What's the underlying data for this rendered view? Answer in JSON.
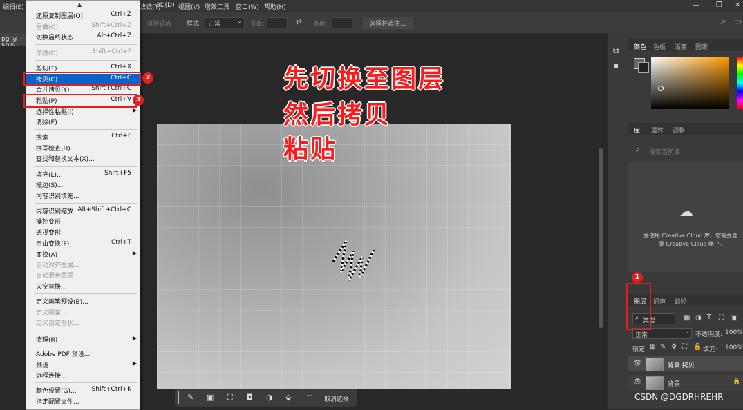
{
  "menubar": {
    "edit": "编辑(E)",
    "items": [
      "滤镜(T)",
      "3D(D)",
      "视图(V)",
      "增效工具",
      "窗口(W)",
      "帮助(H)"
    ],
    "win_min": "—",
    "win_max": "❐",
    "win_close": "✕"
  },
  "optbar": {
    "erase_refine": "消除锯齿",
    "style_label": "样式:",
    "style_value": "正常",
    "width_label": "宽度:",
    "height_label": "高度:",
    "select_subject": "选择并遮住..."
  },
  "doc_tab": "pg @ 50%",
  "annotation": {
    "line1": "先切换至图层",
    "line2": "然后拷贝",
    "line3": "粘贴"
  },
  "edit_menu": {
    "undo": {
      "label": "还原复制图层(O)",
      "shortcut": "Ctrl+Z"
    },
    "redo": {
      "label": "重做(O)",
      "shortcut": "Shift+Ctrl+Z"
    },
    "toggle_last": {
      "label": "切换最终状态",
      "shortcut": "Alt+Ctrl+Z"
    },
    "fade": {
      "label": "渐隐(D)...",
      "shortcut": "Shift+Ctrl+F"
    },
    "cut": {
      "label": "剪切(T)",
      "shortcut": "Ctrl+X"
    },
    "copy": {
      "label": "拷贝(C)",
      "shortcut": "Ctrl+C"
    },
    "copy_merged": {
      "label": "合并拷贝(Y)",
      "shortcut": "Shift+Ctrl+C"
    },
    "paste": {
      "label": "粘贴(P)",
      "shortcut": "Ctrl+V"
    },
    "paste_special": {
      "label": "选择性粘贴(I)"
    },
    "clear": {
      "label": "清除(E)"
    },
    "search": {
      "label": "搜索",
      "shortcut": "Ctrl+F"
    },
    "spell": {
      "label": "拼写检查(H)..."
    },
    "find_replace": {
      "label": "查找和替换文本(X)..."
    },
    "fill": {
      "label": "填充(L)...",
      "shortcut": "Shift+F5"
    },
    "stroke": {
      "label": "描边(S)..."
    },
    "content_fill": {
      "label": "内容识别填充..."
    },
    "content_scale": {
      "label": "内容识别缩放",
      "shortcut": "Alt+Shift+Ctrl+C"
    },
    "puppet": {
      "label": "操控变形"
    },
    "perspective": {
      "label": "透视变形"
    },
    "free_transform": {
      "label": "自由变换(F)",
      "shortcut": "Ctrl+T"
    },
    "transform": {
      "label": "变换(A)"
    },
    "auto_align": {
      "label": "自动对齐图层..."
    },
    "auto_blend": {
      "label": "自动混合图层..."
    },
    "sky_replace": {
      "label": "天空替换..."
    },
    "define_brush": {
      "label": "定义画笔预设(B)..."
    },
    "define_pattern": {
      "label": "定义图案..."
    },
    "define_shape": {
      "label": "定义自定形状..."
    },
    "purge": {
      "label": "清理(R)"
    },
    "pdf_presets": {
      "label": "Adobe PDF 预设..."
    },
    "presets": {
      "label": "预设"
    },
    "remote": {
      "label": "远程连接..."
    },
    "color_settings": {
      "label": "颜色设置(G)...",
      "shortcut": "Shift+Ctrl+K"
    },
    "assign_profile": {
      "label": "指定配置文件..."
    }
  },
  "badges": {
    "b1": "1",
    "b2": "2",
    "b3": "3"
  },
  "panels": {
    "color_tabs": [
      "颜色",
      "色板",
      "渐变",
      "图案"
    ],
    "lib_tabs": [
      "库",
      "属性",
      "调整"
    ],
    "lib_search_placeholder": "搜索当前库",
    "cc_message_1": "要使用 Creative Cloud 库，您需要登",
    "cc_message_2": "录 Creative Cloud 帐户。",
    "layer_tabs": [
      "图层",
      "通道",
      "路径"
    ],
    "filter_kind": "类型",
    "blend_mode": "正常",
    "opacity_label": "不透明度:",
    "opacity_value": "100%",
    "lock_label": "锁定:",
    "fill_label": "填充:",
    "fill_value": "100%",
    "layers": [
      "背景 拷贝",
      "背景"
    ]
  },
  "bottom_bar": {
    "deselect": "取消选择",
    "more": "···"
  },
  "watermark": "CSDN @DGDRHREHR",
  "colors": {
    "highlight": "#0a64c8",
    "annotation": "#ff1a1a",
    "callout": "#e02020"
  }
}
